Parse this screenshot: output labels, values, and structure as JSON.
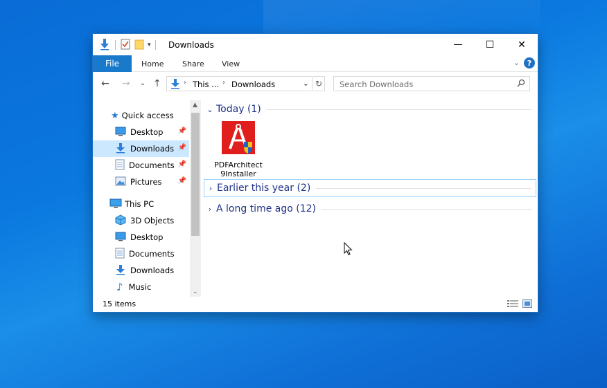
{
  "window": {
    "title": "Downloads",
    "caption": {
      "minimize": "—",
      "maximize": "☐",
      "close": "✕"
    }
  },
  "ribbon": {
    "tabs": [
      "File",
      "Home",
      "Share",
      "View"
    ],
    "help": "?"
  },
  "address": {
    "crumbs": [
      "This ...",
      "Downloads"
    ],
    "search_placeholder": "Search Downloads"
  },
  "navpane": {
    "quick_access_label": "Quick access",
    "quick_access": [
      {
        "label": "Desktop",
        "icon": "desktop-icon",
        "pinned": true
      },
      {
        "label": "Downloads",
        "icon": "downloads-icon",
        "pinned": true,
        "selected": true
      },
      {
        "label": "Documents",
        "icon": "documents-icon",
        "pinned": true
      },
      {
        "label": "Pictures",
        "icon": "pictures-icon",
        "pinned": true
      }
    ],
    "this_pc_label": "This PC",
    "this_pc": [
      {
        "label": "3D Objects",
        "icon": "3d-objects-icon"
      },
      {
        "label": "Desktop",
        "icon": "desktop-icon"
      },
      {
        "label": "Documents",
        "icon": "documents-icon"
      },
      {
        "label": "Downloads",
        "icon": "downloads-icon"
      },
      {
        "label": "Music",
        "icon": "music-icon"
      }
    ]
  },
  "content": {
    "groups": [
      {
        "title": "Today (1)",
        "expanded": true
      },
      {
        "title": "Earlier this year (2)",
        "expanded": false
      },
      {
        "title": "A long time ago (12)",
        "expanded": false
      }
    ],
    "files": [
      {
        "name": "PDFArchitect9Installer",
        "icon": "pdf-architect-installer-icon"
      }
    ]
  },
  "status": {
    "items_count": "15 items"
  },
  "colors": {
    "accent": "#1979ca",
    "group_text": "#1e3287",
    "selection": "#cce8ff",
    "desktop": "#0a78df"
  }
}
